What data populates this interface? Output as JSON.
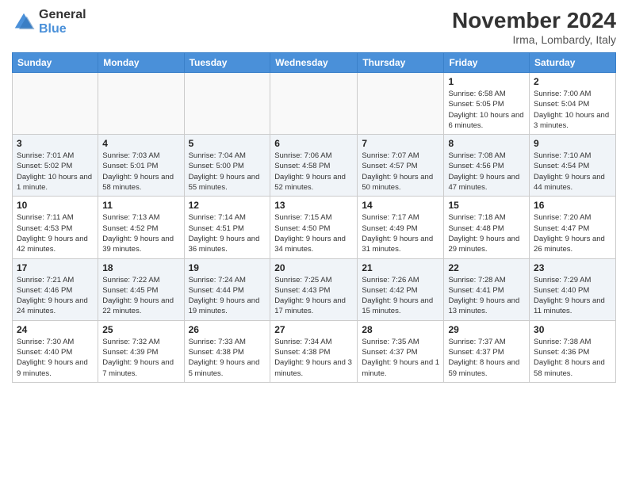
{
  "header": {
    "logo_general": "General",
    "logo_blue": "Blue",
    "month_title": "November 2024",
    "location": "Irma, Lombardy, Italy"
  },
  "weekdays": [
    "Sunday",
    "Monday",
    "Tuesday",
    "Wednesday",
    "Thursday",
    "Friday",
    "Saturday"
  ],
  "weeks": [
    [
      {
        "day": "",
        "info": ""
      },
      {
        "day": "",
        "info": ""
      },
      {
        "day": "",
        "info": ""
      },
      {
        "day": "",
        "info": ""
      },
      {
        "day": "",
        "info": ""
      },
      {
        "day": "1",
        "info": "Sunrise: 6:58 AM\nSunset: 5:05 PM\nDaylight: 10 hours and 6 minutes."
      },
      {
        "day": "2",
        "info": "Sunrise: 7:00 AM\nSunset: 5:04 PM\nDaylight: 10 hours and 3 minutes."
      }
    ],
    [
      {
        "day": "3",
        "info": "Sunrise: 7:01 AM\nSunset: 5:02 PM\nDaylight: 10 hours and 1 minute."
      },
      {
        "day": "4",
        "info": "Sunrise: 7:03 AM\nSunset: 5:01 PM\nDaylight: 9 hours and 58 minutes."
      },
      {
        "day": "5",
        "info": "Sunrise: 7:04 AM\nSunset: 5:00 PM\nDaylight: 9 hours and 55 minutes."
      },
      {
        "day": "6",
        "info": "Sunrise: 7:06 AM\nSunset: 4:58 PM\nDaylight: 9 hours and 52 minutes."
      },
      {
        "day": "7",
        "info": "Sunrise: 7:07 AM\nSunset: 4:57 PM\nDaylight: 9 hours and 50 minutes."
      },
      {
        "day": "8",
        "info": "Sunrise: 7:08 AM\nSunset: 4:56 PM\nDaylight: 9 hours and 47 minutes."
      },
      {
        "day": "9",
        "info": "Sunrise: 7:10 AM\nSunset: 4:54 PM\nDaylight: 9 hours and 44 minutes."
      }
    ],
    [
      {
        "day": "10",
        "info": "Sunrise: 7:11 AM\nSunset: 4:53 PM\nDaylight: 9 hours and 42 minutes."
      },
      {
        "day": "11",
        "info": "Sunrise: 7:13 AM\nSunset: 4:52 PM\nDaylight: 9 hours and 39 minutes."
      },
      {
        "day": "12",
        "info": "Sunrise: 7:14 AM\nSunset: 4:51 PM\nDaylight: 9 hours and 36 minutes."
      },
      {
        "day": "13",
        "info": "Sunrise: 7:15 AM\nSunset: 4:50 PM\nDaylight: 9 hours and 34 minutes."
      },
      {
        "day": "14",
        "info": "Sunrise: 7:17 AM\nSunset: 4:49 PM\nDaylight: 9 hours and 31 minutes."
      },
      {
        "day": "15",
        "info": "Sunrise: 7:18 AM\nSunset: 4:48 PM\nDaylight: 9 hours and 29 minutes."
      },
      {
        "day": "16",
        "info": "Sunrise: 7:20 AM\nSunset: 4:47 PM\nDaylight: 9 hours and 26 minutes."
      }
    ],
    [
      {
        "day": "17",
        "info": "Sunrise: 7:21 AM\nSunset: 4:46 PM\nDaylight: 9 hours and 24 minutes."
      },
      {
        "day": "18",
        "info": "Sunrise: 7:22 AM\nSunset: 4:45 PM\nDaylight: 9 hours and 22 minutes."
      },
      {
        "day": "19",
        "info": "Sunrise: 7:24 AM\nSunset: 4:44 PM\nDaylight: 9 hours and 19 minutes."
      },
      {
        "day": "20",
        "info": "Sunrise: 7:25 AM\nSunset: 4:43 PM\nDaylight: 9 hours and 17 minutes."
      },
      {
        "day": "21",
        "info": "Sunrise: 7:26 AM\nSunset: 4:42 PM\nDaylight: 9 hours and 15 minutes."
      },
      {
        "day": "22",
        "info": "Sunrise: 7:28 AM\nSunset: 4:41 PM\nDaylight: 9 hours and 13 minutes."
      },
      {
        "day": "23",
        "info": "Sunrise: 7:29 AM\nSunset: 4:40 PM\nDaylight: 9 hours and 11 minutes."
      }
    ],
    [
      {
        "day": "24",
        "info": "Sunrise: 7:30 AM\nSunset: 4:40 PM\nDaylight: 9 hours and 9 minutes."
      },
      {
        "day": "25",
        "info": "Sunrise: 7:32 AM\nSunset: 4:39 PM\nDaylight: 9 hours and 7 minutes."
      },
      {
        "day": "26",
        "info": "Sunrise: 7:33 AM\nSunset: 4:38 PM\nDaylight: 9 hours and 5 minutes."
      },
      {
        "day": "27",
        "info": "Sunrise: 7:34 AM\nSunset: 4:38 PM\nDaylight: 9 hours and 3 minutes."
      },
      {
        "day": "28",
        "info": "Sunrise: 7:35 AM\nSunset: 4:37 PM\nDaylight: 9 hours and 1 minute."
      },
      {
        "day": "29",
        "info": "Sunrise: 7:37 AM\nSunset: 4:37 PM\nDaylight: 8 hours and 59 minutes."
      },
      {
        "day": "30",
        "info": "Sunrise: 7:38 AM\nSunset: 4:36 PM\nDaylight: 8 hours and 58 minutes."
      }
    ]
  ]
}
